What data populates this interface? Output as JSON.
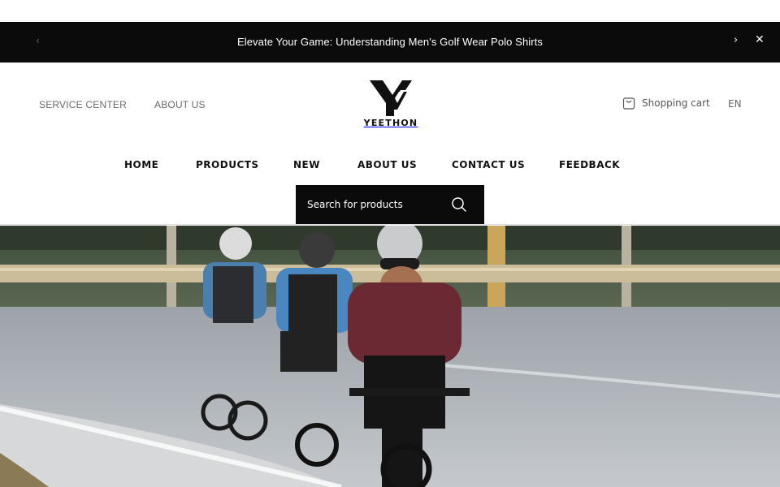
{
  "announcement": {
    "text": "Elevate Your Game: Understanding Men's Golf Wear Polo Shirts",
    "prev_icon": "chevron-left-icon",
    "next_icon": "chevron-right-icon",
    "close_icon": "close-icon"
  },
  "utility_links": {
    "service_center": "SERVICE CENTER",
    "about_us": "ABOUT US"
  },
  "brand": {
    "name": "YEETHON",
    "logo_icon": "yeethon-logo-icon"
  },
  "cart": {
    "label": "Shopping cart",
    "icon": "shopping-bag-icon"
  },
  "language": "EN",
  "nav": {
    "items": [
      {
        "label": "HOME"
      },
      {
        "label": "PRODUCTS"
      },
      {
        "label": "NEW"
      },
      {
        "label": "ABOUT US"
      },
      {
        "label": "CONTACT US"
      },
      {
        "label": "FEEDBACK"
      }
    ]
  },
  "search": {
    "placeholder": "Search for products",
    "icon": "search-icon"
  },
  "hero": {
    "image": "cyclists-on-road-banner"
  },
  "colors": {
    "bar_background": "#0b0b0b",
    "text_dark": "#111111",
    "text_muted": "#6a6a6a"
  }
}
